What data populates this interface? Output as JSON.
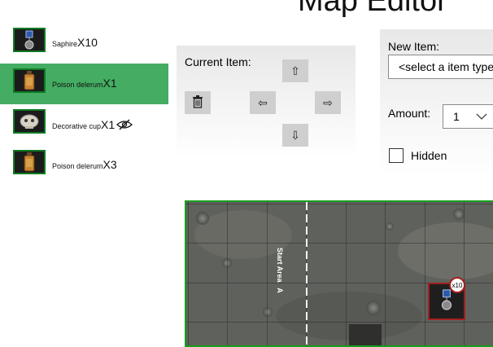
{
  "window": {
    "title": "Map Editor"
  },
  "items": [
    {
      "name": "Saphire",
      "count": "X10",
      "icon": "sapphire-gem-icon",
      "selected": false,
      "hidden": false
    },
    {
      "name": "Poison delerum",
      "count": "X1",
      "icon": "poison-flask-icon",
      "selected": true,
      "hidden": false
    },
    {
      "name": "Decorative cup",
      "count": "X1",
      "icon": "decorative-cup-icon",
      "selected": false,
      "hidden": true
    },
    {
      "name": "Poison delerum",
      "count": "X3",
      "icon": "poison-flask-icon",
      "selected": false,
      "hidden": false
    }
  ],
  "current_item": {
    "label": "Current Item:",
    "buttons": {
      "up": "⇧",
      "left": "⇦",
      "right": "⇨",
      "down": "⇩"
    }
  },
  "new_item": {
    "label": "New Item:",
    "select_placeholder": "<select a item type>",
    "amount_label": "Amount:",
    "amount_value": "1",
    "hidden_label": "Hidden",
    "hidden_checked": false
  },
  "map": {
    "start_label": "Start Area",
    "start_sub": "A",
    "token_badge": "x10",
    "token_icon": "sapphire-gem-icon"
  },
  "colors": {
    "selected_row": "#44ad63",
    "map_border": "#159f1c",
    "token_border": "#a21f1f"
  }
}
